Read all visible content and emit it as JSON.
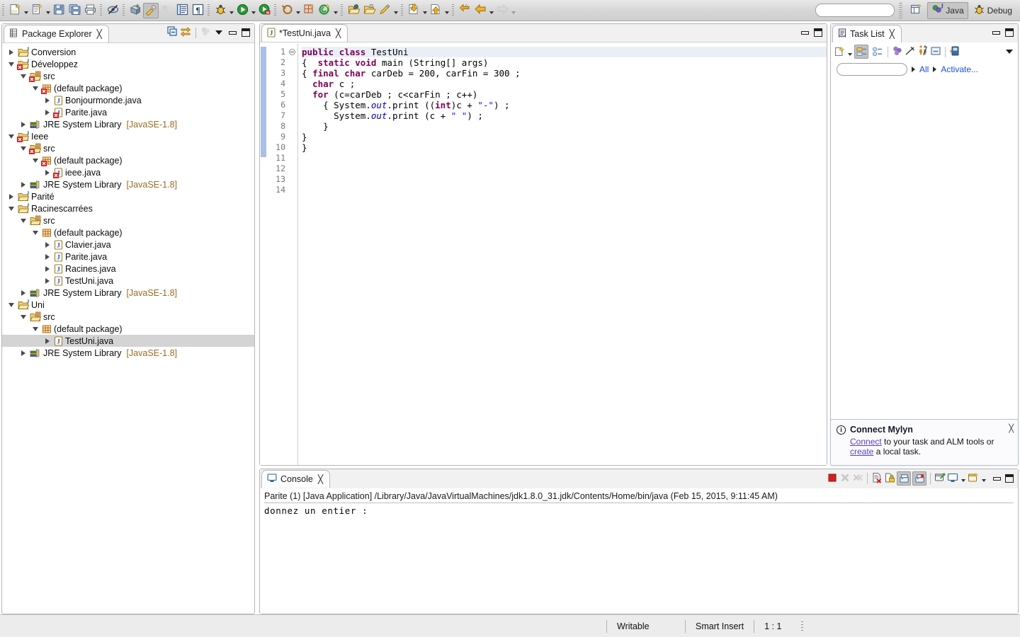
{
  "window": {
    "title": "Eclipse IDE - TestUni.java"
  },
  "toolbar": {
    "search_placeholder": "",
    "search_value": "",
    "buttons": [
      {
        "name": "new-wizard-button",
        "icon": "new-file-icon",
        "label": "New",
        "has_dropdown": true
      },
      {
        "name": "new-java-class-button",
        "icon": "new-java-class-icon",
        "label": "New Java Class",
        "has_dropdown": true
      },
      {
        "name": "save-button",
        "icon": "save-icon",
        "label": "Save"
      },
      {
        "name": "save-all-button",
        "icon": "save-all-icon",
        "label": "Save All"
      },
      {
        "name": "print-button",
        "icon": "print-icon",
        "label": "Print"
      },
      {
        "name": "toggle-mark-occurrences-button",
        "icon": "mark-occurrences-off-icon",
        "label": "Toggle Mark Occurrences"
      },
      {
        "name": "new-java-project-button",
        "icon": "new-java-project-icon",
        "label": "New Java Project"
      },
      {
        "name": "open-task-button",
        "icon": "paintbrush-icon",
        "label": "Open Task",
        "pressed": true
      },
      {
        "name": "disconnect-button",
        "icon": "mylyn-disabled-icon",
        "label": "Disconnected"
      },
      {
        "name": "outline-button",
        "icon": "outline-icon",
        "label": "Show Outline"
      },
      {
        "name": "paragraph-button",
        "icon": "pilcrow-icon",
        "label": "Show Whitespace"
      },
      {
        "name": "debug-button",
        "icon": "debug-bug-icon",
        "label": "Debug",
        "has_dropdown": true
      },
      {
        "name": "run-button",
        "icon": "run-play-icon",
        "label": "Run",
        "has_dropdown": true
      },
      {
        "name": "run-coverage-button",
        "icon": "coverage-icon",
        "label": "Coverage"
      },
      {
        "name": "external-tools-button",
        "icon": "external-tools-icon",
        "label": "External Tools",
        "has_dropdown": true
      },
      {
        "name": "new-junit-button",
        "icon": "new-junit-test-icon",
        "label": "New JUnit Test"
      },
      {
        "name": "new-annotation-button",
        "icon": "new-annotation-icon",
        "label": "New Annotation",
        "has_dropdown": true
      },
      {
        "name": "open-type-button",
        "icon": "open-type-icon",
        "label": "Open Type"
      },
      {
        "name": "open-task-folder-button",
        "icon": "open-folder-icon",
        "label": "Open Task"
      },
      {
        "name": "edit-button",
        "icon": "pen-icon",
        "label": "Edit",
        "has_dropdown": true
      },
      {
        "name": "next-annotation-button",
        "icon": "next-annotation-icon",
        "label": "Next Annotation",
        "has_dropdown": true
      },
      {
        "name": "previous-annotation-button",
        "icon": "previous-annotation-icon",
        "label": "Previous Annotation",
        "has_dropdown": true
      },
      {
        "name": "last-edit-location-button",
        "icon": "last-edit-location-icon",
        "label": "Last Edit Location"
      },
      {
        "name": "back-button",
        "icon": "back-arrow-icon",
        "label": "Back",
        "has_dropdown": true
      },
      {
        "name": "forward-button",
        "icon": "forward-arrow-icon",
        "label": "Forward",
        "has_dropdown": true,
        "disabled": true
      }
    ],
    "perspectives": [
      {
        "name": "open-perspective-button",
        "icon": "open-perspective-icon",
        "label": ""
      },
      {
        "name": "perspective-java",
        "icon": "java-perspective-icon",
        "label": "Java",
        "active": true
      },
      {
        "name": "perspective-debug",
        "icon": "debug-perspective-icon",
        "label": "Debug",
        "active": false
      }
    ]
  },
  "package_explorer": {
    "tab_label": "Package Explorer",
    "close_glyph": "✄",
    "toolbar": [
      {
        "name": "collapse-all-button",
        "icon": "collapse-all-icon"
      },
      {
        "name": "link-with-editor-button",
        "icon": "link-with-editor-icon"
      },
      {
        "name": "focus-on-active-task-button",
        "icon": "focus-active-task-icon",
        "disabled": true
      },
      {
        "name": "view-menu-button",
        "icon": "chevron-down-icon"
      },
      {
        "name": "minimize-button",
        "icon": "minimize-icon"
      },
      {
        "name": "maximize-button",
        "icon": "maximize-icon"
      }
    ],
    "tree": [
      {
        "indent": 0,
        "state": "closed",
        "icon": "java-project-icon",
        "label": "Conversion",
        "suffix": "",
        "error": false,
        "selected": false
      },
      {
        "indent": 0,
        "state": "open",
        "icon": "java-project-icon",
        "label": "Développez",
        "suffix": "",
        "error": true,
        "selected": false
      },
      {
        "indent": 1,
        "state": "open",
        "icon": "source-folder-icon",
        "label": "src",
        "suffix": "",
        "error": true,
        "selected": false
      },
      {
        "indent": 2,
        "state": "open",
        "icon": "package-icon",
        "label": "(default package)",
        "suffix": "",
        "error": true,
        "selected": false
      },
      {
        "indent": 3,
        "state": "closed",
        "icon": "java-file-icon",
        "label": "Bonjourmonde.java",
        "suffix": "",
        "error": false,
        "selected": false
      },
      {
        "indent": 3,
        "state": "closed",
        "icon": "java-file-icon",
        "label": "Parite.java",
        "suffix": "",
        "error": true,
        "selected": false
      },
      {
        "indent": 1,
        "state": "closed",
        "icon": "jre-library-icon",
        "label": "JRE System Library",
        "suffix": "[JavaSE-1.8]",
        "error": false,
        "selected": false
      },
      {
        "indent": 0,
        "state": "open",
        "icon": "java-project-icon",
        "label": "Ieee",
        "suffix": "",
        "error": true,
        "selected": false
      },
      {
        "indent": 1,
        "state": "open",
        "icon": "source-folder-icon",
        "label": "src",
        "suffix": "",
        "error": true,
        "selected": false
      },
      {
        "indent": 2,
        "state": "open",
        "icon": "package-icon",
        "label": "(default package)",
        "suffix": "",
        "error": true,
        "selected": false
      },
      {
        "indent": 3,
        "state": "closed",
        "icon": "java-file-icon",
        "label": "ieee.java",
        "suffix": "",
        "error": true,
        "selected": false
      },
      {
        "indent": 1,
        "state": "closed",
        "icon": "jre-library-icon",
        "label": "JRE System Library",
        "suffix": "[JavaSE-1.8]",
        "error": false,
        "selected": false
      },
      {
        "indent": 0,
        "state": "closed",
        "icon": "java-project-icon",
        "label": "Parité",
        "suffix": "",
        "error": false,
        "selected": false
      },
      {
        "indent": 0,
        "state": "open",
        "icon": "java-project-icon",
        "label": "Racinescarrées",
        "suffix": "",
        "error": false,
        "selected": false
      },
      {
        "indent": 1,
        "state": "open",
        "icon": "source-folder-icon",
        "label": "src",
        "suffix": "",
        "error": false,
        "selected": false
      },
      {
        "indent": 2,
        "state": "open",
        "icon": "package-icon",
        "label": "(default package)",
        "suffix": "",
        "error": false,
        "selected": false
      },
      {
        "indent": 3,
        "state": "closed",
        "icon": "java-file-icon",
        "label": "Clavier.java",
        "suffix": "",
        "error": false,
        "selected": false
      },
      {
        "indent": 3,
        "state": "closed",
        "icon": "java-file-icon",
        "label": "Parite.java",
        "suffix": "",
        "error": false,
        "selected": false
      },
      {
        "indent": 3,
        "state": "closed",
        "icon": "java-file-icon",
        "label": "Racines.java",
        "suffix": "",
        "error": false,
        "selected": false
      },
      {
        "indent": 3,
        "state": "closed",
        "icon": "java-file-icon",
        "label": "TestUni.java",
        "suffix": "",
        "error": false,
        "selected": false
      },
      {
        "indent": 1,
        "state": "closed",
        "icon": "jre-library-icon",
        "label": "JRE System Library",
        "suffix": "[JavaSE-1.8]",
        "error": false,
        "selected": false
      },
      {
        "indent": 0,
        "state": "open",
        "icon": "java-project-icon",
        "label": "Uni",
        "suffix": "",
        "error": false,
        "selected": false
      },
      {
        "indent": 1,
        "state": "open",
        "icon": "source-folder-icon",
        "label": "src",
        "suffix": "",
        "error": false,
        "selected": false
      },
      {
        "indent": 2,
        "state": "open",
        "icon": "package-icon",
        "label": "(default package)",
        "suffix": "",
        "error": false,
        "selected": false
      },
      {
        "indent": 3,
        "state": "closed",
        "icon": "java-file-icon",
        "label": "TestUni.java",
        "suffix": "",
        "error": false,
        "selected": true
      },
      {
        "indent": 1,
        "state": "closed",
        "icon": "jre-library-icon",
        "label": "JRE System Library",
        "suffix": "[JavaSE-1.8]",
        "error": false,
        "selected": false
      }
    ]
  },
  "editor": {
    "tab_label": "*TestUni.java",
    "tab_icon": "java-file-icon",
    "dirty": true,
    "controls": [
      {
        "name": "minimize-button",
        "icon": "minimize-icon"
      },
      {
        "name": "maximize-button",
        "icon": "maximize-icon"
      }
    ],
    "line_numbers": [
      "1",
      "2",
      "3",
      "4",
      "5",
      "6",
      "7",
      "8",
      "9",
      "10",
      "11",
      "12",
      "13",
      "14"
    ],
    "fold_line": 2,
    "lines": [
      [
        {
          "t": "public ",
          "c": "kw"
        },
        {
          "t": "class ",
          "c": "kw"
        },
        {
          "t": "TestUni",
          "c": ""
        }
      ],
      [
        {
          "t": "{  ",
          "c": ""
        },
        {
          "t": "static ",
          "c": "kw"
        },
        {
          "t": "void ",
          "c": "kw"
        },
        {
          "t": "main (String[] args)",
          "c": ""
        }
      ],
      [
        {
          "t": "{ ",
          "c": ""
        },
        {
          "t": "final ",
          "c": "kw"
        },
        {
          "t": "char ",
          "c": "kw"
        },
        {
          "t": "carDeb = 200, carFin = 300 ;",
          "c": ""
        }
      ],
      [
        {
          "t": "  ",
          "c": ""
        },
        {
          "t": "char ",
          "c": "kw"
        },
        {
          "t": "c ;",
          "c": ""
        }
      ],
      [
        {
          "t": "  ",
          "c": ""
        },
        {
          "t": "for ",
          "c": "kw"
        },
        {
          "t": "(c=carDeb ; c<carFin ; c++)",
          "c": ""
        }
      ],
      [
        {
          "t": "    { System.",
          "c": ""
        },
        {
          "t": "out",
          "c": "fld"
        },
        {
          "t": ".print ((",
          "c": ""
        },
        {
          "t": "int",
          "c": "kw"
        },
        {
          "t": ")c + ",
          "c": ""
        },
        {
          "t": "\"-\"",
          "c": "str"
        },
        {
          "t": ") ;",
          "c": ""
        }
      ],
      [
        {
          "t": "      System.",
          "c": ""
        },
        {
          "t": "out",
          "c": "fld"
        },
        {
          "t": ".print (c + ",
          "c": ""
        },
        {
          "t": "\" \"",
          "c": "str"
        },
        {
          "t": ") ;",
          "c": ""
        }
      ],
      [
        {
          "t": "    }",
          "c": ""
        }
      ],
      [
        {
          "t": "}",
          "c": ""
        }
      ],
      [
        {
          "t": "}",
          "c": ""
        }
      ],
      [],
      [],
      [],
      []
    ]
  },
  "task_list": {
    "tab_label": "Task List",
    "close_glyph": "✄",
    "toolbar": [
      {
        "name": "new-task-button",
        "icon": "new-task-icon",
        "has_dropdown": true
      },
      {
        "name": "categorized-presentation-button",
        "icon": "categorized-icon",
        "pressed": true
      },
      {
        "name": "scheduled-presentation-button",
        "icon": "scheduled-icon"
      },
      {
        "name": "focus-on-workweek-button",
        "icon": "focus-workweek-icon"
      },
      {
        "name": "synchronize-changed-button",
        "icon": "synchronize-icon"
      },
      {
        "name": "collapse-all-tasks-button",
        "icon": "collapse-all-tasks-icon"
      },
      {
        "name": "restore-tasks-button",
        "icon": "restore-tasks-icon"
      },
      {
        "name": "link-with-editor-task-button",
        "icon": "link-editor-task-icon"
      },
      {
        "name": "view-menu-button",
        "icon": "chevron-down-icon"
      }
    ],
    "controls": [
      {
        "name": "minimize-button",
        "icon": "minimize-icon"
      },
      {
        "name": "maximize-button",
        "icon": "maximize-icon"
      }
    ],
    "filter_placeholder": "",
    "filter_value": "",
    "links": [
      {
        "name": "all-filter-link",
        "label": "All"
      },
      {
        "name": "activate-task-link",
        "label": "Activate..."
      }
    ]
  },
  "mylyn_notice": {
    "icon": "info-icon",
    "title": "Connect Mylyn",
    "link1": "Connect",
    "text1": " to your task and ALM tools or",
    "link2": "create",
    "text2": " a local task.",
    "close_glyph": "✄"
  },
  "console": {
    "tab_label": "Console",
    "close_glyph": "✄",
    "header_line": "Parite (1) [Java Application] /Library/Java/JavaVirtualMachines/jdk1.8.0_31.jdk/Contents/Home/bin/java (Feb 15, 2015, 9:11:45 AM)",
    "output": "donnez un entier :",
    "toolbar": [
      {
        "name": "terminate-button",
        "icon": "stop-square-icon",
        "color": "#d52020"
      },
      {
        "name": "remove-launch-button",
        "icon": "remove-x-icon",
        "disabled": true
      },
      {
        "name": "remove-all-terminated-button",
        "icon": "remove-all-x-icon",
        "disabled": true
      },
      {
        "name": "clear-console-button",
        "icon": "clear-console-icon"
      },
      {
        "name": "scroll-lock-button",
        "icon": "scroll-lock-icon"
      },
      {
        "name": "show-console-on-output-button",
        "icon": "show-console-output-icon",
        "pressed": true
      },
      {
        "name": "show-console-on-error-button",
        "icon": "show-console-error-icon",
        "pressed": true
      },
      {
        "name": "pin-console-button",
        "icon": "pin-console-icon"
      },
      {
        "name": "display-selected-console-button",
        "icon": "display-console-icon",
        "has_dropdown": true
      },
      {
        "name": "open-console-button",
        "icon": "open-console-icon",
        "has_dropdown": true
      },
      {
        "name": "minimize-button",
        "icon": "minimize-icon"
      },
      {
        "name": "maximize-button",
        "icon": "maximize-icon"
      }
    ]
  },
  "status_bar": {
    "writable": "Writable",
    "insert_mode": "Smart Insert",
    "position": "1 : 1"
  },
  "colors": {
    "keyword": "#7f0055",
    "string": "#2a00ff",
    "field": "#0000c0",
    "link": "#1a4fd6",
    "suffix": "#9b6b22",
    "selection": "#d4d4d4",
    "current_line": "#eaeff7",
    "change_bar": "#a9c0e4"
  }
}
